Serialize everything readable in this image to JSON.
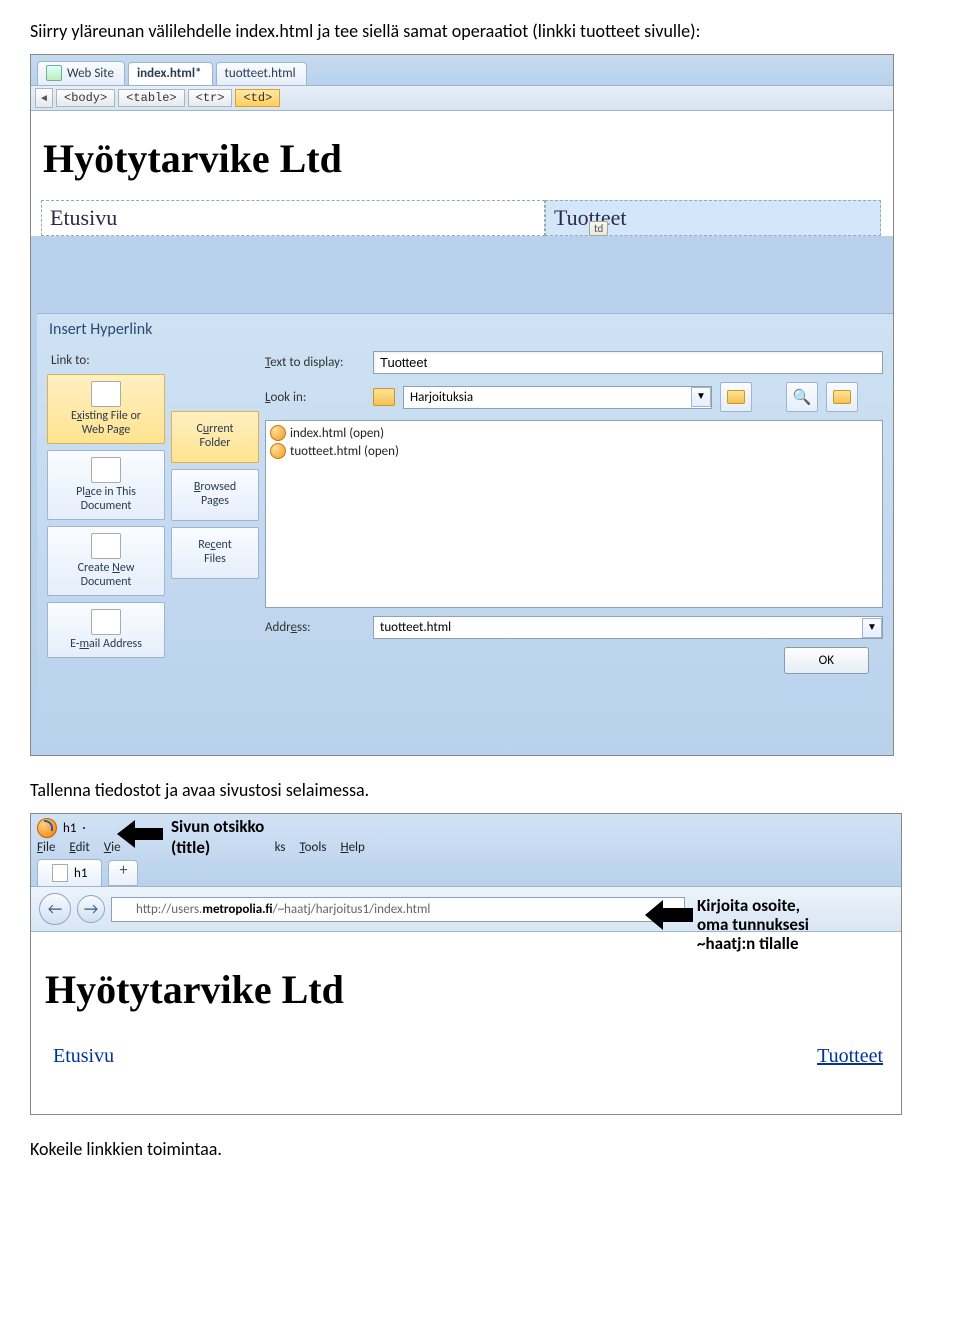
{
  "doc": {
    "line1": "Siirry yläreunan välilehdelle index.html ja tee siellä samat operaatiot (linkki tuotteet sivulle):",
    "line2": "Tallenna tiedostot ja avaa sivustosi selaimessa.",
    "line3": "Kokeile linkkien toimintaa."
  },
  "editor": {
    "tabs": {
      "website": "Web Site",
      "index": "index.html*",
      "tuotteet": "tuotteet.html"
    },
    "breadcrumb": [
      "<body>",
      "<table>",
      "<tr>",
      "<td>"
    ],
    "h1": "Hyötytarvike Ltd",
    "cell_left": "Etusivu",
    "cell_right": "Tuotteet",
    "tag_marker": "td"
  },
  "hyperlink": {
    "title": "Insert Hyperlink",
    "link_to_label": "Link to:",
    "text_label": "Text to display:",
    "text_value": "Tuotteet",
    "lookin_label": "Look in:",
    "lookin_value": "Harjoituksia",
    "side": {
      "existing": "Existing File or Web Page",
      "placein": "Place in This Document",
      "createnew": "Create New Document",
      "email": "E-mail Address"
    },
    "mid": {
      "current": "Current Folder",
      "browsed": "Browsed Pages",
      "recent": "Recent Files"
    },
    "files": {
      "f1": "index.html (open)",
      "f2": "tuotteet.html (open)"
    },
    "address_label": "Address:",
    "address_value": "tuotteet.html",
    "ok": "OK"
  },
  "browser": {
    "titletab": "h1",
    "annot1": "Sivun otsikko\n(title)",
    "annot2": "Kirjoita osoite,\noma tunnuksesi\n~haatj:n tilalle",
    "menus": [
      "File",
      "Edit",
      "Vie",
      "ks",
      "Tools",
      "Help"
    ],
    "url_prefix": "http://users.",
    "url_bold": "metropolia.fi",
    "url_suffix": "/~haatj/harjoitus1/index.html",
    "h1": "Hyötytarvike Ltd",
    "nav_left": "Etusivu",
    "nav_right": "Tuotteet"
  }
}
